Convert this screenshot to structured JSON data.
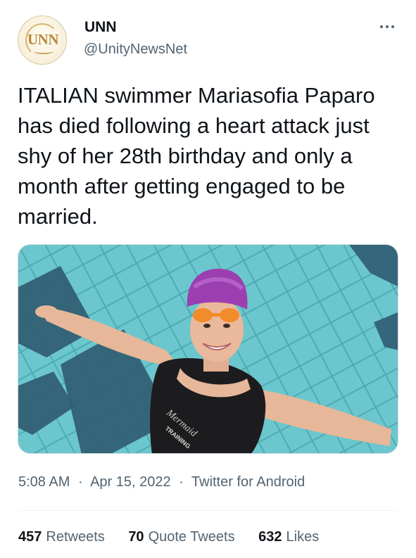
{
  "tweet": {
    "author": {
      "name": "UNN",
      "handle": "@UnityNewsNet",
      "avatar_text": "UNN"
    },
    "text": "ITALIAN swimmer Mariasofia Paparo has died following a heart attack just shy of her 28th birthday and only a month after getting engaged to be married.",
    "media": {
      "swimsuit_text": "Mermaid TRAINING"
    },
    "meta": {
      "time": "5:08 AM",
      "date": "Apr 15, 2022",
      "source": "Twitter for Android",
      "separator": "·"
    },
    "stats": {
      "retweets_count": "457",
      "retweets_label": "Retweets",
      "quotes_count": "70",
      "quotes_label": "Quote Tweets",
      "likes_count": "632",
      "likes_label": "Likes"
    }
  },
  "icons": {
    "more": "more-horizontal-icon"
  },
  "colors": {
    "text_primary": "#0f1419",
    "text_secondary": "#536471",
    "pool_water": "#5fc3c9",
    "pool_tile_dark": "#1f4f66",
    "cap": "#9b3fb0",
    "goggles": "#f28c2a"
  }
}
